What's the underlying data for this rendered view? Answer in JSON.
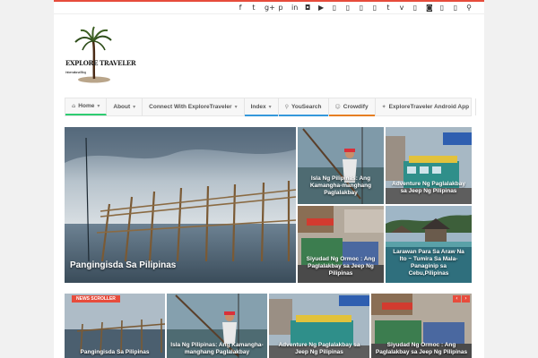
{
  "social_icons": [
    "facebook-icon",
    "twitter-icon",
    "google-plus-icon",
    "pinterest-icon",
    "linkedin-icon",
    "flickr-icon",
    "youtube-icon",
    "icon-7",
    "icon-8",
    "icon-9",
    "icon-10",
    "tumblr-icon",
    "vimeo-icon",
    "icon-13",
    "instagram-icon",
    "icon-15",
    "icon-16",
    "search-icon"
  ],
  "social_glyphs": [
    "f",
    "t",
    "g+",
    "p",
    "in",
    "◘",
    "▶",
    "▯",
    "▯",
    "▯",
    "▯",
    "t",
    "v",
    "▯",
    "◙",
    "▯",
    "▯",
    "⚲"
  ],
  "logo": {
    "line1": "EXPLORE",
    "line2": "TRAVELER",
    "tagline": "Informational Blog"
  },
  "nav": [
    {
      "label": "Home",
      "icon": "⌂",
      "caret": "▾",
      "color": "#2ecc71",
      "active": true
    },
    {
      "label": "About",
      "icon": "",
      "caret": "▾",
      "color": "",
      "active": false
    },
    {
      "label": "Connect With ExploreTraveler",
      "icon": "",
      "caret": "▾",
      "color": "",
      "active": false
    },
    {
      "label": "Index",
      "icon": "",
      "caret": "▾",
      "color": "#3498db",
      "active": false
    },
    {
      "label": "YouSearch",
      "icon": "⚲",
      "caret": "",
      "color": "#3498db",
      "active": false
    },
    {
      "label": "Crowdify",
      "icon": "☺",
      "caret": "",
      "color": "#e67e22",
      "active": false
    },
    {
      "label": "ExploreTraveler Android App",
      "icon": "✦",
      "caret": "",
      "color": "",
      "active": false
    }
  ],
  "featured": {
    "main": "Pangingisda Sa Pilipinas",
    "tiles": [
      "Isla Ng Pilipinas: Ang Kamangha-manghang Paglalakbay",
      "Adventure Ng Paglalakbay sa Jeep Ng Pilipinas",
      "Siyudad Ng Ormoc : Ang Paglalakbay sa Jeep Ng Pilipinas",
      "Larawan Para Sa Araw Na Ito ~ Tumira Sa Mala-Panaginip sa Cebu,Pilipinas"
    ]
  },
  "scroller": {
    "badge": "NEWS SCROLLER",
    "prev": "‹",
    "next": "›",
    "items": [
      "Pangingisda Sa Pilipinas",
      "Isla Ng Pilipinas: Ang Kamangha-manghang Paglalakbay",
      "Adventure Ng Paglalakbay sa Jeep Ng Pilipinas",
      "Siyudad Ng Ormoc : Ang Paglalakbay sa Jeep Ng Pilipinas"
    ]
  },
  "colors": {
    "accent": "#e74c3c",
    "home_underline": "#2ecc71",
    "index_underline": "#3498db",
    "crowdify_underline": "#e67e22"
  }
}
